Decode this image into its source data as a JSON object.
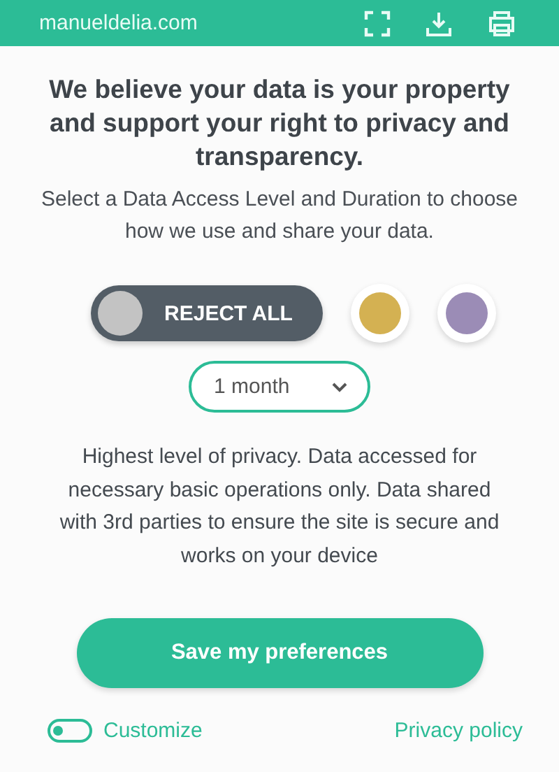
{
  "top_bar": {
    "site": "manueldelia.com"
  },
  "heading": "We believe your data is your property and support your right to privacy and transparency.",
  "intro": "Select a Data Access Level and Duration to choose how we use and share your data.",
  "levels": [
    {
      "label": "REJECT ALL",
      "color": "#c3c3c3",
      "selected": true
    },
    {
      "color": "#d4b152",
      "selected": false
    },
    {
      "color": "#9b8cb6",
      "selected": false
    }
  ],
  "duration": {
    "value": "1 month"
  },
  "description": "Highest level of privacy. Data accessed for necessary basic operations only. Data shared with 3rd parties to ensure the site is secure and works on your device",
  "save_button": "Save my preferences",
  "customize": {
    "label": "Customize",
    "on": false
  },
  "privacy_link": "Privacy policy"
}
